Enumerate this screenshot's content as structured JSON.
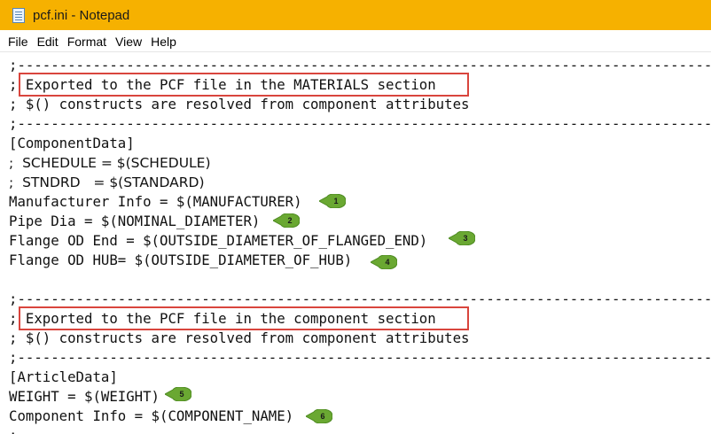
{
  "window": {
    "title": "pcf.ini - Notepad"
  },
  "menu": [
    "File",
    "Edit",
    "Format",
    "View",
    "Help"
  ],
  "lines": [
    ";---------------------------------------------------------------------------------------------------",
    "; Exported to the PCF file in the MATERIALS section",
    "; $() constructs are resolved from component attributes",
    ";---------------------------------------------------------------------------------------------------",
    "[ComponentData]",
    ";  SCHEDULE = $(SCHEDULE)",
    ";  STNDRD   = $(STANDARD)",
    "Manufacturer Info = $(MANUFACTURER)",
    "Pipe Dia = $(NOMINAL_DIAMETER)",
    "Flange OD End = $(OUTSIDE_DIAMETER_OF_FLANGED_END)",
    "Flange OD HUB= $(OUTSIDE_DIAMETER_OF_HUB)",
    "",
    ";---------------------------------------------------------------------------------------------------",
    "; Exported to the PCF file in the component section",
    "; $() constructs are resolved from component attributes",
    ";---------------------------------------------------------------------------------------------------",
    "[ArticleData]",
    "WEIGHT = $(WEIGHT)",
    "Component Info = $(COMPONENT_NAME)",
    ";"
  ],
  "callouts": [
    "1",
    "2",
    "3",
    "4",
    "5",
    "6"
  ],
  "colors": {
    "titlebar": "#f6b100",
    "highlight_box": "#d9453d",
    "callout_fill": "#6aa832"
  }
}
